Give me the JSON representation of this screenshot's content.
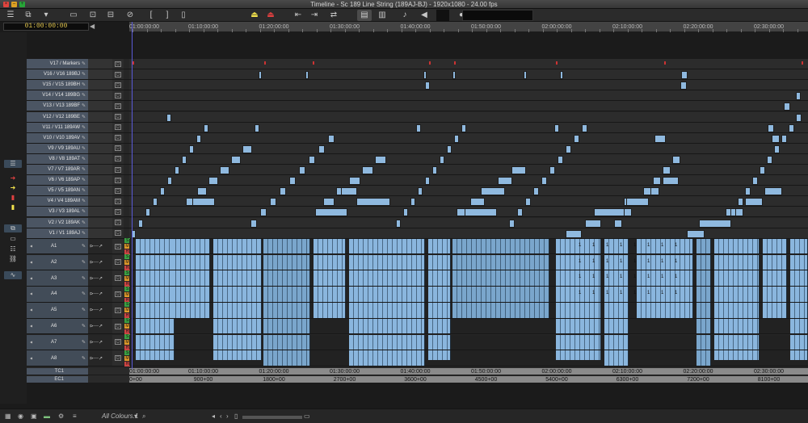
{
  "window": {
    "title": "Timeline - Sc 189 Line String (189AJ-BJ) - 1920x1080 - 24.00 fps"
  },
  "timecode": {
    "master": "01:00:00:00"
  },
  "colors": {
    "clip": "#8fb9df",
    "header": "#4b5563",
    "playhead": "#5a5ad8",
    "timecode": "#e2c64e",
    "marker": "#cc3333"
  },
  "toolbar": {
    "icons": [
      "sliders-icon",
      "segment-icon",
      "triangle-down-icon",
      "monitor-icon",
      "lift-icon",
      "extract-icon",
      "clear-icon",
      "mark-in-icon",
      "mark-out-icon",
      "mark-clip-icon",
      "top-icon",
      "red-icon",
      "splice-icon",
      "overwrite-icon",
      "sync-icon",
      "timeline-view-icon",
      "clip-color-icon",
      "audio-icon",
      "speaker-icon",
      "record-icon",
      "circle-icon",
      "text-icon"
    ]
  },
  "ruler": {
    "labels": [
      "01:00:00:00",
      "01:10:00:00",
      "01:20:00:00",
      "01:30:00:00",
      "01:40:00:00",
      "01:50:00:00",
      "02:00:00:00",
      "02:10:00:00",
      "02:20:00:00",
      "02:30:00:00"
    ]
  },
  "video_tracks": [
    {
      "name": "V17 / Markers"
    },
    {
      "name": "V16 / V16  189BJ"
    },
    {
      "name": "V15 / V15  189BH"
    },
    {
      "name": "V14 / V14  189BG"
    },
    {
      "name": "V13 / V13  189BF"
    },
    {
      "name": "V12 / V12  189BE"
    },
    {
      "name": "V11 / V11  189AW"
    },
    {
      "name": "V10 / V10  189AV"
    },
    {
      "name": "V9 / V9  189AU"
    },
    {
      "name": "V8 / V8  189AT"
    },
    {
      "name": "V7 / V7  189AR"
    },
    {
      "name": "V6 / V6  189AP"
    },
    {
      "name": "V5 / V5  189AN"
    },
    {
      "name": "V4 / V4  189AM"
    },
    {
      "name": "V3 / V3  189AL"
    },
    {
      "name": "V2 / V2  189AK"
    },
    {
      "name": "V1 / V1  189AJ"
    }
  ],
  "audio_tracks": [
    {
      "name": "A1"
    },
    {
      "name": "A2"
    },
    {
      "name": "A3"
    },
    {
      "name": "A4"
    },
    {
      "name": "A5"
    },
    {
      "name": "A6"
    },
    {
      "name": "A7"
    },
    {
      "name": "A8"
    }
  ],
  "audio_buttons": [
    "S",
    "M",
    "H"
  ],
  "tc_tracks": [
    {
      "name": "TC1",
      "values": [
        "01:00:00:00",
        "01:10:00:00",
        "01:20:00:00",
        "01:30:00:00",
        "01:40:00:00",
        "01:50:00:00",
        "02:00:00:00",
        "02:10:00:00",
        "02:20:00:00",
        "02:30:00:00"
      ]
    },
    {
      "name": "EC1",
      "values": [
        "0+00",
        "900+00",
        "1800+00",
        "2700+00",
        "3600+00",
        "4500+00",
        "5400+00",
        "6300+00",
        "7200+00",
        "8100+00"
      ]
    }
  ],
  "clip_number": "1",
  "bottom": {
    "colour_filter": "All Colours.1"
  }
}
